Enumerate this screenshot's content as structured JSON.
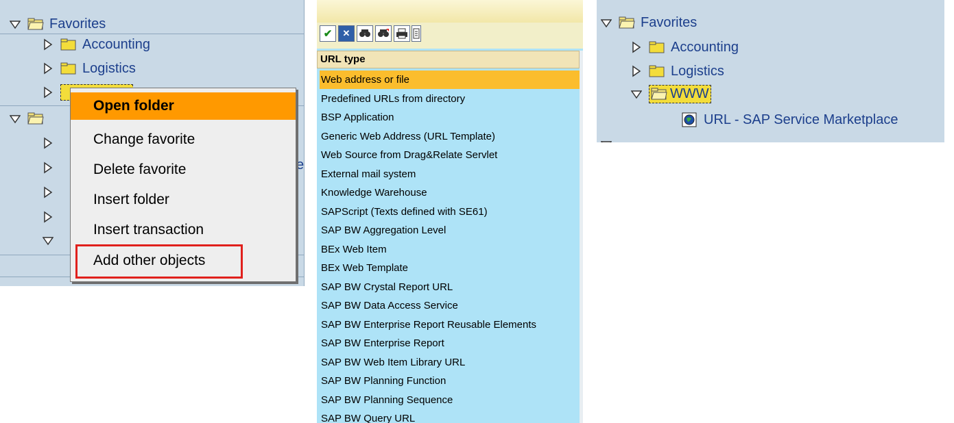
{
  "left_panel": {
    "tree": {
      "favorites": "Favorites",
      "accounting": "Accounting",
      "logistics": "Logistics",
      "partial_char": "e"
    },
    "context_menu": {
      "items": [
        {
          "label": "Open folder"
        },
        {
          "label": "Change favorite"
        },
        {
          "label": "Delete favorite"
        },
        {
          "label": "Insert folder"
        },
        {
          "label": "Insert transaction"
        },
        {
          "label": "Add other objects"
        }
      ],
      "highlight_color": "#ff9900",
      "callout_color": "#e0201c"
    }
  },
  "middle_panel": {
    "toolbar_icons": [
      "checkmark-icon",
      "cancel-icon",
      "find-icon",
      "find-next-icon",
      "print-icon",
      "info-icon"
    ],
    "header": "URL type",
    "items": [
      "Web address or file",
      "Predefined URLs from directory",
      "BSP Application",
      "Generic Web Address (URL Template)",
      "Web Source from Drag&Relate Servlet",
      "External mail system",
      "Knowledge Warehouse",
      "SAPScript (Texts defined with SE61)",
      "SAP BW Aggregation Level",
      "BEx Web Item",
      "BEx Web Template",
      "SAP BW  Crystal Report  URL",
      "SAP BW Data Access Service",
      "SAP BW Enterprise Report Reusable Elements",
      "SAP BW  Enterprise Report",
      "SAP BW  Web Item Library  URL",
      "SAP BW Planning Function",
      "SAP BW Planning Sequence",
      "SAP BW  Query  URL"
    ],
    "selected_index": 0,
    "selected_color": "#fbbd2d",
    "list_bg": "#aee3f7"
  },
  "right_panel": {
    "tree": {
      "favorites": "Favorites",
      "accounting": "Accounting",
      "logistics": "Logistics",
      "www": "WWW",
      "url_item": "URL - SAP Service Marketplace"
    }
  }
}
